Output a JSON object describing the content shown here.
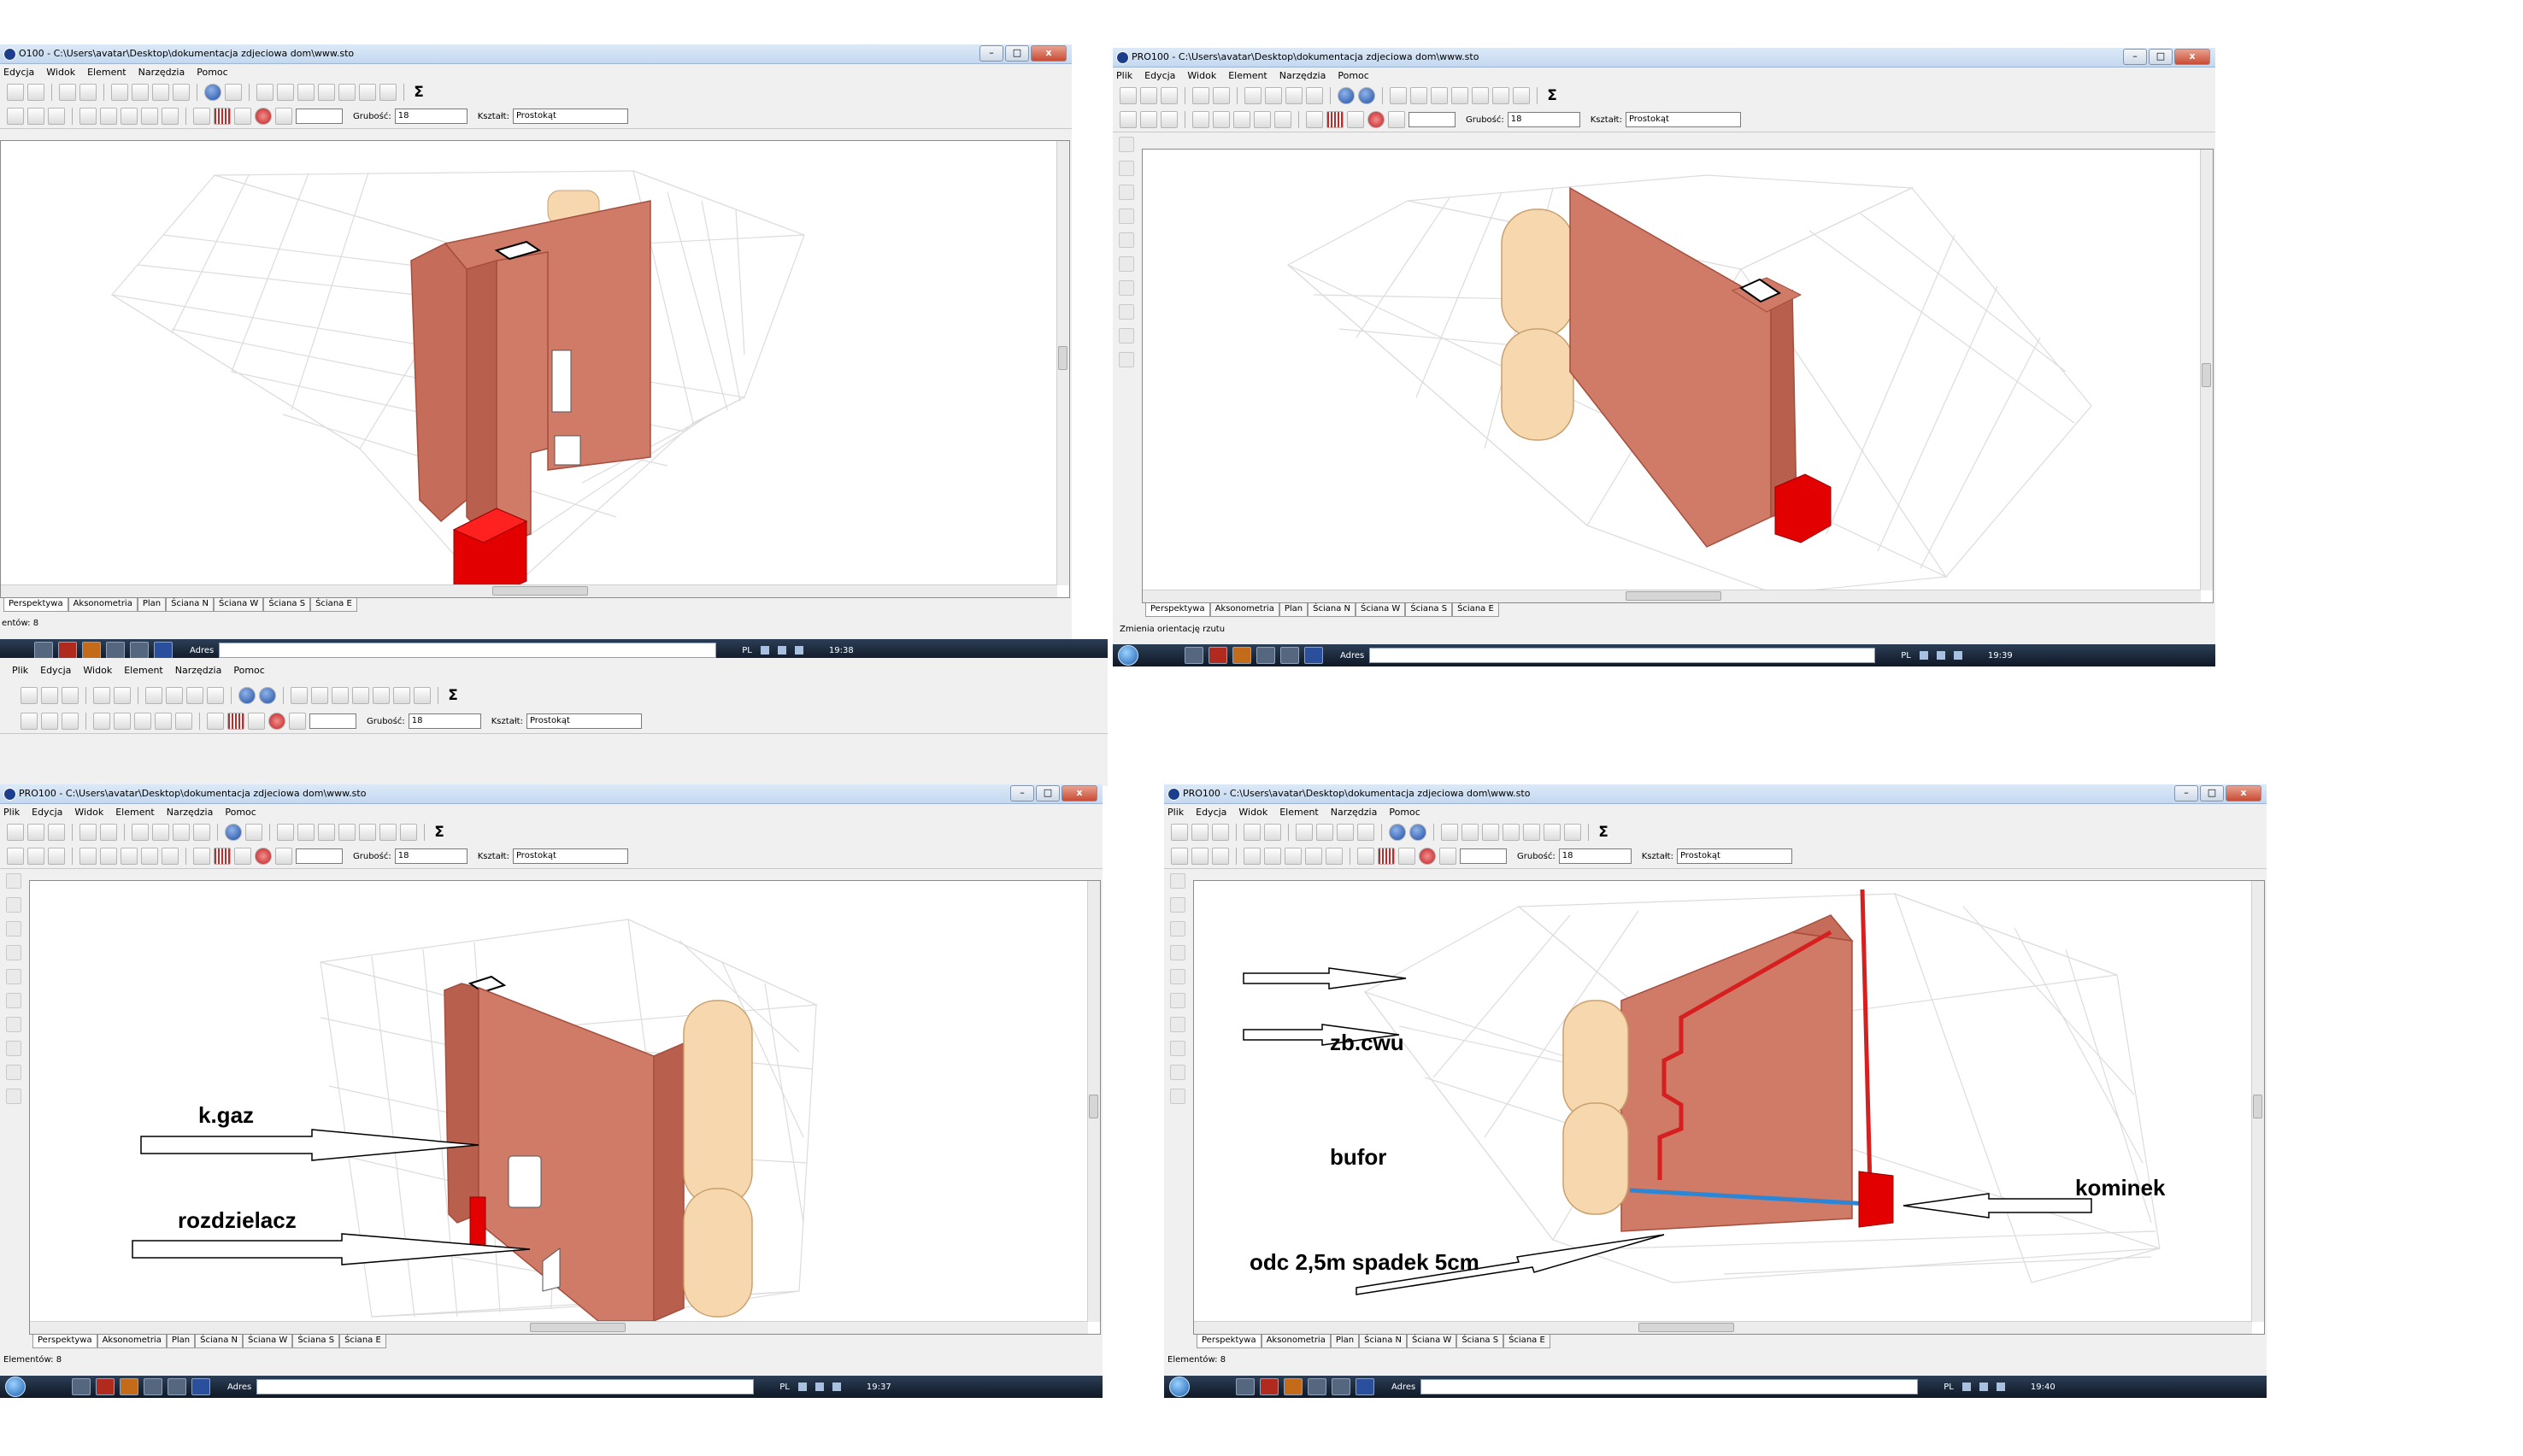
{
  "common": {
    "menu": [
      "Plik",
      "Edycja",
      "Widok",
      "Element",
      "Narzędzia",
      "Pomoc"
    ],
    "menu_tl": [
      "Edycja",
      "Widok",
      "Element",
      "Narzędzia",
      "Pomoc"
    ],
    "gruboscLabel": "Grubość:",
    "gruboscValue": "18",
    "ksztaltLabel": "Kształt:",
    "ksztaltValue": "Prostokąt",
    "tabs": [
      "Perspektywa",
      "Aksonometria",
      "Plan",
      "Ściana N",
      "Ściana W",
      "Ściana S",
      "Ściana E"
    ],
    "addressLabel": "Adres",
    "trayLang": "PL",
    "sigma": "Σ",
    "min": "–",
    "max": "□",
    "close": "x"
  },
  "windows": {
    "tl": {
      "title": "O100 - C:\\Users\\avatar\\Desktop\\dokumentacja zdjeciowa dom\\www.sto",
      "status": "entów: 8",
      "clock": "19:38"
    },
    "tr": {
      "title": "PRO100 - C:\\Users\\avatar\\Desktop\\dokumentacja zdjeciowa dom\\www.sto",
      "status": "Zmienia orientację rzutu",
      "clock": "19:39"
    },
    "bl": {
      "title": "PRO100 - C:\\Users\\avatar\\Desktop\\dokumentacja zdjeciowa dom\\www.sto",
      "status": "Elementów: 8",
      "clock": "19:37"
    },
    "br": {
      "title": "PRO100 - C:\\Users\\avatar\\Desktop\\dokumentacja zdjeciowa dom\\www.sto",
      "status": "Elementów: 8",
      "clock": "19:40"
    }
  },
  "annotations": {
    "kgaz": "k.gaz",
    "rozdzielacz": "rozdzielacz",
    "zbcwu": "zb.cwu",
    "bufor": "bufor",
    "kominek": "kominek",
    "odc": "odc 2,5m spadek 5cm"
  },
  "colors": {
    "wall": "#d07a68",
    "wallDark": "#a64e3e",
    "boiler": "#dd0000",
    "tank": "#f6d7ae",
    "tankEdge": "#c9a06e",
    "pipeRed": "#d61f1f",
    "pipeBlue": "#2b86d6",
    "grid": "#dcdcdc"
  }
}
